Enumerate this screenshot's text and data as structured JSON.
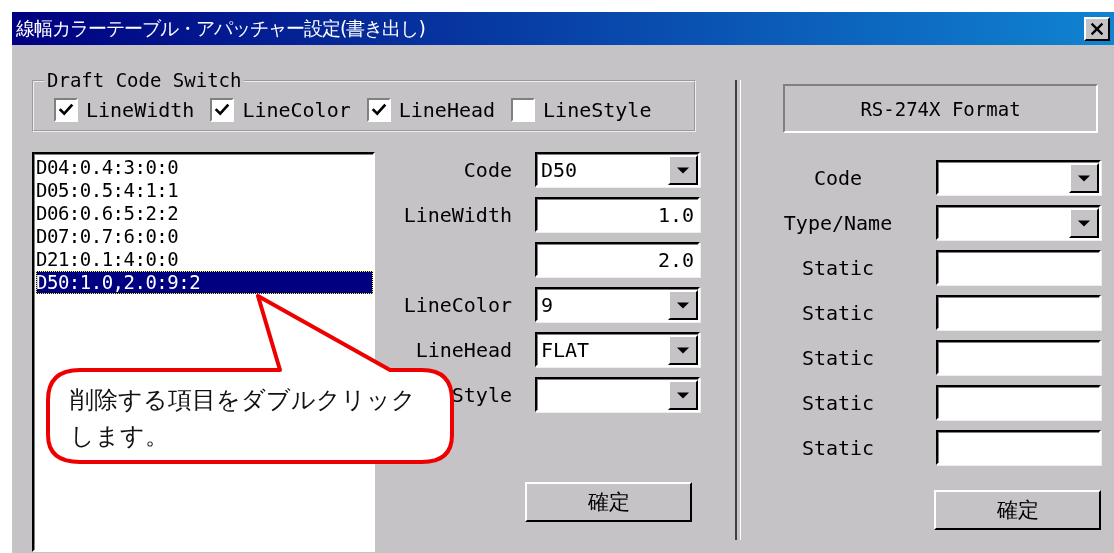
{
  "window": {
    "title": "線幅カラーテーブル・アパッチャー設定(書き出し)"
  },
  "draft_code_switch": {
    "title": "Draft Code Switch",
    "options": [
      {
        "label": "LineWidth",
        "checked": true
      },
      {
        "label": "LineColor",
        "checked": true
      },
      {
        "label": "LineHead",
        "checked": true
      },
      {
        "label": "LineStyle",
        "checked": false
      }
    ]
  },
  "code_list": {
    "items": [
      {
        "text": "D04:0.4:3:0:0",
        "selected": false
      },
      {
        "text": "D05:0.5:4:1:1",
        "selected": false
      },
      {
        "text": "D06:0.6:5:2:2",
        "selected": false
      },
      {
        "text": "D07:0.7:6:0:0",
        "selected": false
      },
      {
        "text": "D21:0.1:4:0:0",
        "selected": false
      },
      {
        "text": "D50:1.0,2.0:9:2",
        "selected": true
      }
    ]
  },
  "line_form": {
    "rows": [
      {
        "label": "Code",
        "kind": "dropdown",
        "value": "D50"
      },
      {
        "label": "LineWidth",
        "kind": "number",
        "value": "1.0"
      },
      {
        "kind": "number",
        "value": "2.0"
      },
      {
        "label": "LineColor",
        "kind": "dropdown",
        "value": "9"
      },
      {
        "label": "LineHead",
        "kind": "dropdown",
        "value": "FLAT"
      },
      {
        "label": "Style",
        "kind": "dropdown"
      }
    ],
    "button": "確定"
  },
  "format_panel": {
    "title": "RS-274X Format",
    "rows": [
      {
        "label": "Code",
        "kind": "dropdown"
      },
      {
        "label": "Type/Name",
        "kind": "dropdown"
      },
      {
        "label": "Static",
        "kind": "text"
      },
      {
        "label": "Static",
        "kind": "text"
      },
      {
        "label": "Static",
        "kind": "text"
      },
      {
        "label": "Static",
        "kind": "text"
      },
      {
        "label": "Static",
        "kind": "text"
      }
    ],
    "button": "確定"
  },
  "callout": {
    "text": "削除する項目をダブルクリックします。"
  }
}
